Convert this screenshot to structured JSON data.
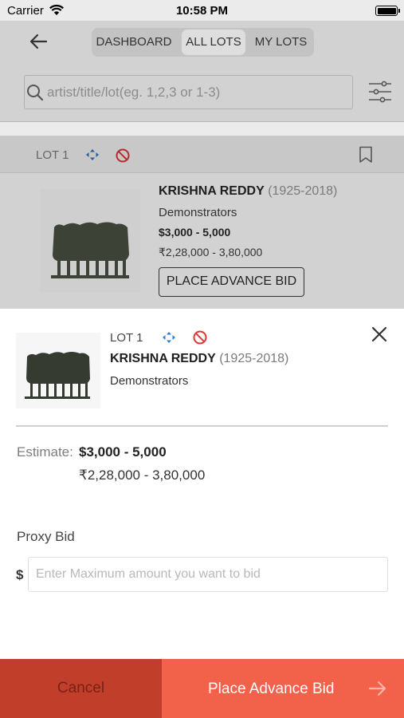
{
  "status_bar": {
    "carrier": "Carrier",
    "time": "10:58 PM"
  },
  "nav": {
    "tabs": [
      {
        "label": "DASHBOARD",
        "active": false
      },
      {
        "label": "ALL LOTS",
        "active": true
      },
      {
        "label": "MY LOTS",
        "active": false
      }
    ]
  },
  "search": {
    "placeholder": "artist/title/lot(eg. 1,2,3 or 1-3)"
  },
  "lot_list": {
    "lot_label": "LOT  1",
    "artist": "KRISHNA REDDY",
    "years": "(1925-2018)",
    "title": "Demonstrators",
    "estimate_usd": "$3,000 - 5,000",
    "estimate_inr": "₹2,28,000 - 3,80,000",
    "advance_bid_label": "PLACE ADVANCE BID"
  },
  "sheet": {
    "lot_label": "LOT  1",
    "artist": "KRISHNA REDDY",
    "years": "(1925-2018)",
    "title": "Demonstrators",
    "estimate_label": "Estimate:",
    "estimate_usd": "$3,000 - 5,000",
    "estimate_inr": "₹2,28,000 - 3,80,000",
    "proxy_bid_label": "Proxy Bid",
    "currency_symbol": "$",
    "bid_placeholder": "Enter Maximum amount you want to bid",
    "cancel_label": "Cancel",
    "submit_label": "Place Advance Bid"
  },
  "colors": {
    "cancel_bg": "#c13e2b",
    "submit_bg": "#f2624a",
    "move_icon": "#2a7fd4",
    "no_icon": "#e03535"
  },
  "icons": [
    "wifi-icon",
    "battery-icon",
    "back-arrow-icon",
    "search-icon",
    "filter-sliders-icon",
    "move-arrows-icon",
    "no-entry-icon",
    "bookmark-icon",
    "close-icon",
    "arrow-right-icon"
  ]
}
